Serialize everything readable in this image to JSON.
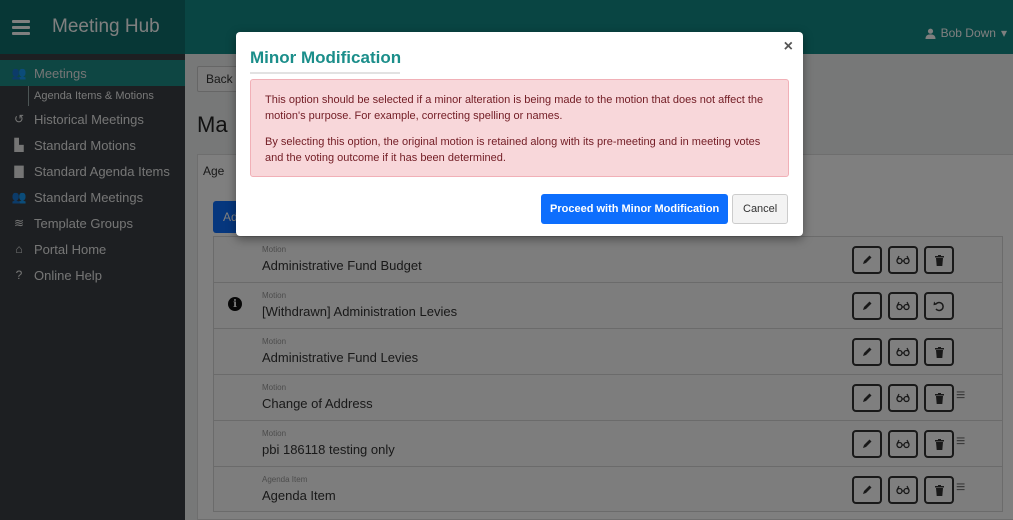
{
  "header": {
    "brand": "Meeting Hub",
    "user": "Bob Down",
    "accent": "#138a86"
  },
  "sidebar": {
    "items": [
      {
        "label": "Meetings",
        "icon": "users-icon",
        "active": true
      },
      {
        "label": "Agenda Items & Motions",
        "icon": "",
        "sub": true
      },
      {
        "label": "Historical Meetings",
        "icon": "history-icon"
      },
      {
        "label": "Standard Motions",
        "icon": "gavel-icon"
      },
      {
        "label": "Standard Agenda Items",
        "icon": "book-icon"
      },
      {
        "label": "Standard Meetings",
        "icon": "group-icon"
      },
      {
        "label": "Template Groups",
        "icon": "layers-icon"
      },
      {
        "label": "Portal Home",
        "icon": "home-icon"
      },
      {
        "label": "Online Help",
        "icon": "help-icon"
      }
    ]
  },
  "main": {
    "back_label": "Back",
    "page_title": "Ma",
    "tab_label": "Age",
    "add_label": "Ad",
    "rows": [
      {
        "kind": "Motion",
        "label": "Administrative Fund Budget",
        "info": false,
        "third": "trash",
        "drag": false
      },
      {
        "kind": "Motion",
        "label": "[Withdrawn] Administration Levies",
        "info": true,
        "third": "undo",
        "drag": false
      },
      {
        "kind": "Motion",
        "label": "Administrative Fund Levies",
        "info": false,
        "third": "trash",
        "drag": false
      },
      {
        "kind": "Motion",
        "label": "Change of Address",
        "info": false,
        "third": "trash",
        "drag": true
      },
      {
        "kind": "Motion",
        "label": "pbi 186118 testing only",
        "info": false,
        "third": "trash",
        "drag": true
      },
      {
        "kind": "Agenda Item",
        "label": "Agenda Item",
        "info": false,
        "third": "trash",
        "drag": true
      }
    ]
  },
  "modal": {
    "title": "Minor Modification",
    "paragraph1": "This option should be selected if a minor alteration is being made to the motion that does not affect the motion's purpose. For example, correcting spelling or names.",
    "paragraph2": "By selecting this option, the original motion is retained along with its pre-meeting and in meeting votes and the voting outcome if it has been determined.",
    "proceed_label": "Proceed with Minor Modification",
    "cancel_label": "Cancel"
  }
}
